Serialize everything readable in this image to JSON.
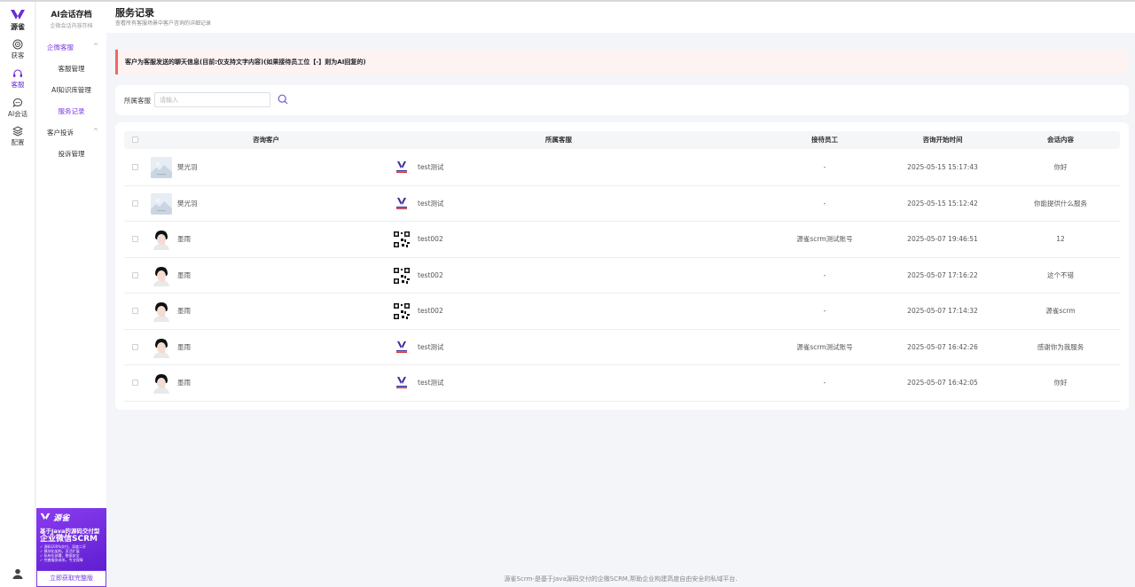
{
  "rail": {
    "logo_text": "源雀",
    "items": [
      {
        "label": "获客",
        "icon": "target-icon"
      },
      {
        "label": "客服",
        "icon": "headset-icon",
        "active": true
      },
      {
        "label": "AI会话",
        "icon": "chat-icon"
      },
      {
        "label": "配置",
        "icon": "layers-icon"
      }
    ]
  },
  "submenu": {
    "title": "AI会话存档",
    "subtitle": "企微会话内容存档",
    "group1": "企微客服",
    "group1_items": [
      "客服管理",
      "AI知识库管理",
      "服务记录"
    ],
    "group2": "客户投诉",
    "group2_items": [
      "投诉管理"
    ]
  },
  "promo": {
    "logo": "源雀",
    "line1": "基于Java的源码交付型",
    "line2": "企业微信SCRM",
    "bullets": [
      "✓ 源码100%交付，深度二开",
      "✓ 模块化架构，灵活扩展",
      "✓ 私有化部署，数据安全",
      "✓ 完善服务体系，专业保障"
    ],
    "button": "立即获取完整版"
  },
  "header": {
    "title": "服务记录",
    "subtitle": "查看所有客服场景中客户咨询的详细记录"
  },
  "alert": {
    "text": "客户为客服发送的聊天信息(目前:仅支持文字内容)(如果接待员工位【-】则为AI回复的)"
  },
  "filter": {
    "label": "所属客服",
    "placeholder": "请输入"
  },
  "table": {
    "columns": [
      "咨询客户",
      "所属客服",
      "接待员工",
      "咨询开始时间",
      "会话内容"
    ],
    "rows": [
      {
        "customer": "樊光羽",
        "avatar": "landscape",
        "service": "test测试",
        "service_icon": "brand",
        "staff": "-",
        "time": "2025-05-15 15:17:43",
        "content": "你好"
      },
      {
        "customer": "樊光羽",
        "avatar": "landscape",
        "service": "test测试",
        "service_icon": "brand",
        "staff": "-",
        "time": "2025-05-15 15:12:42",
        "content": "你能提供什么服务"
      },
      {
        "customer": "墨雨",
        "avatar": "person",
        "service": "test002",
        "service_icon": "qr",
        "staff": "源雀scrm测试账号",
        "time": "2025-05-07 19:46:51",
        "content": "12"
      },
      {
        "customer": "墨雨",
        "avatar": "person",
        "service": "test002",
        "service_icon": "qr",
        "staff": "-",
        "time": "2025-05-07 17:16:22",
        "content": "这个不错"
      },
      {
        "customer": "墨雨",
        "avatar": "person",
        "service": "test002",
        "service_icon": "qr",
        "staff": "-",
        "time": "2025-05-07 17:14:32",
        "content": "源雀scrm"
      },
      {
        "customer": "墨雨",
        "avatar": "person",
        "service": "test测试",
        "service_icon": "brand",
        "staff": "源雀scrm测试账号",
        "time": "2025-05-07 16:42:26",
        "content": "感谢你为我服务"
      },
      {
        "customer": "墨雨",
        "avatar": "person",
        "service": "test测试",
        "service_icon": "brand",
        "staff": "-",
        "time": "2025-05-07 16:42:05",
        "content": "你好"
      }
    ]
  },
  "footer": {
    "text": "源雀Scrm-是基于Java源码交付的企微SCRM,帮助企业构建高度自由安全的私域平台."
  },
  "colors": {
    "accent": "#7a3ce0",
    "alert_bar": "#f06666"
  }
}
